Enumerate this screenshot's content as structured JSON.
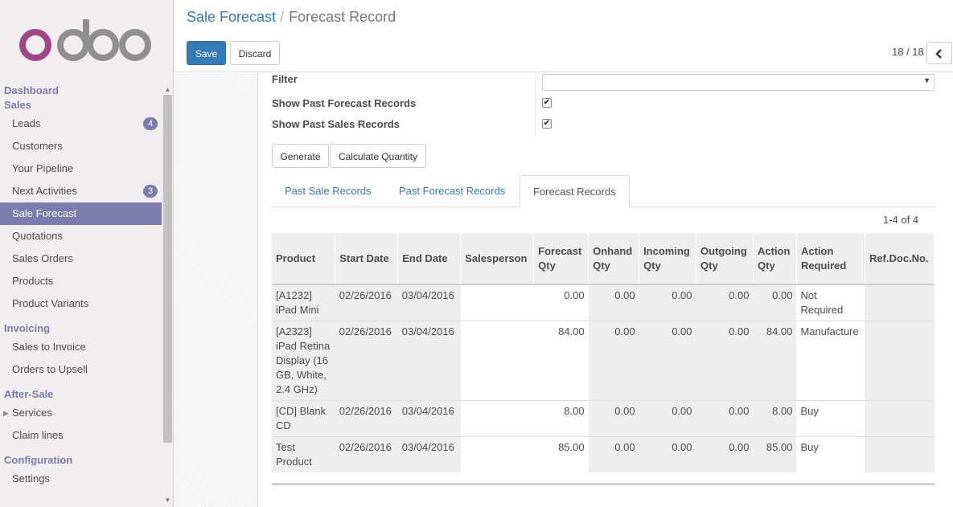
{
  "brand": "odoo",
  "sidebar": {
    "sections": [
      {
        "title": "Dashboard",
        "items": []
      },
      {
        "title": "Sales",
        "items": [
          {
            "label": "Leads",
            "badge": "4"
          },
          {
            "label": "Customers"
          },
          {
            "label": "Your Pipeline"
          },
          {
            "label": "Next Activities",
            "badge": "3"
          },
          {
            "label": "Sale Forecast",
            "active": true
          },
          {
            "label": "Quotations"
          },
          {
            "label": "Sales Orders"
          },
          {
            "label": "Products"
          },
          {
            "label": "Product Variants"
          }
        ]
      },
      {
        "title": "Invoicing",
        "items": [
          {
            "label": "Sales to Invoice"
          },
          {
            "label": "Orders to Upsell"
          }
        ]
      },
      {
        "title": "After-Sale",
        "items": [
          {
            "label": "Services",
            "collapsed": true
          },
          {
            "label": "Claim lines"
          }
        ]
      },
      {
        "title": "Configuration",
        "items": [
          {
            "label": "Settings"
          }
        ]
      }
    ]
  },
  "breadcrumb": {
    "parent": "Sale Forecast",
    "separator": "/",
    "current": "Forecast Record"
  },
  "toolbar": {
    "save_label": "Save",
    "discard_label": "Discard"
  },
  "pager": {
    "value": "18 / 18"
  },
  "form": {
    "filter_label": "Filter",
    "filter_value": "",
    "show_past_forecast_label": "Show Past Forecast Records",
    "show_past_forecast_checked": true,
    "show_past_sales_label": "Show Past Sales Records",
    "show_past_sales_checked": true,
    "generate_label": "Generate",
    "calculate_label": "Calculate Quantity"
  },
  "tabs": [
    {
      "label": "Past Sale Records"
    },
    {
      "label": "Past Forecast Records"
    },
    {
      "label": "Forecast Records",
      "active": true
    }
  ],
  "records_count": "1-4 of 4",
  "table": {
    "columns": [
      "Product",
      "Start Date",
      "End Date",
      "Salesperson",
      "Forecast Qty",
      "Onhand Qty",
      "Incoming Qty",
      "Outgoing Qty",
      "Action Qty",
      "Action Required",
      "Ref.Doc.No."
    ],
    "rows": [
      [
        "[A1232] iPad Mini",
        "02/26/2016",
        "03/04/2016",
        "",
        "0.00",
        "0.00",
        "0.00",
        "0.00",
        "0.00",
        "Not Required",
        ""
      ],
      [
        "[A2323] iPad Retina Display (16 GB, White, 2.4 GHz)",
        "02/26/2016",
        "03/04/2016",
        "",
        "84.00",
        "0.00",
        "0.00",
        "0.00",
        "84.00",
        "Manufacture",
        ""
      ],
      [
        "[CD] Blank CD",
        "02/26/2016",
        "03/04/2016",
        "",
        "8.00",
        "0.00",
        "0.00",
        "0.00",
        "8.00",
        "Buy",
        ""
      ],
      [
        "Test Product",
        "02/26/2016",
        "03/04/2016",
        "",
        "85.00",
        "0.00",
        "0.00",
        "0.00",
        "85.00",
        "Buy",
        ""
      ]
    ]
  },
  "colors": {
    "accent": "#7c7bad",
    "primary": "#337ab7",
    "logo_o": "#a24689",
    "logo_gray": "#8f8f8f"
  }
}
